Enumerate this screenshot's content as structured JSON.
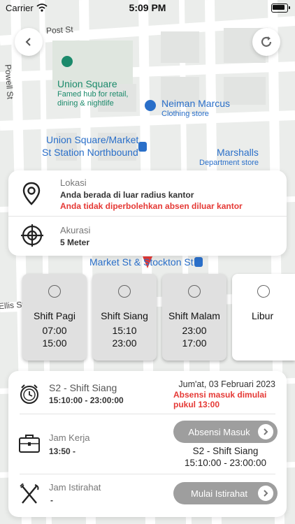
{
  "status_bar": {
    "carrier": "Carrier",
    "time": "5:09 PM"
  },
  "map": {
    "streets": [
      "Post St",
      "Powell St",
      "Ellis St",
      "Market St & Stockton St"
    ],
    "pois": [
      {
        "name": "Union Square",
        "desc1": "Famed hub for retail,",
        "desc2": "dining & nightlife"
      },
      {
        "name": "Neiman Marcus",
        "desc1": "Clothing store"
      },
      {
        "name": "Union Square/Market",
        "desc1": "St Station Northbound"
      },
      {
        "name": "Marshalls",
        "desc1": "Department store"
      }
    ]
  },
  "location_card": {
    "location_label": "Lokasi",
    "location_value": "Anda berada di luar radius kantor",
    "location_warning": "Anda tidak diperbolehkan absen diluar kantor",
    "accuracy_label": "Akurasi",
    "accuracy_value": "5 Meter"
  },
  "shifts": [
    {
      "name": "Shift Pagi",
      "start": "07:00",
      "end": "15:00"
    },
    {
      "name": "Shift Siang",
      "start": "15:10",
      "end": "23:00"
    },
    {
      "name": "Shift Malam",
      "start": "23:00",
      "end": "17:00"
    },
    {
      "name": "Libur"
    }
  ],
  "attendance_card": {
    "shift_title": "S2 - Shift Siang",
    "shift_time": "15:10:00 - 23:00:00",
    "date": "Jum'at, 03 Februari 2023",
    "notice_line1": "Absensi masuk dimulai",
    "notice_line2": "pukul 13:00",
    "work_label": "Jam Kerja",
    "work_value": "13:50 -",
    "checkin_button": "Absensi Masuk",
    "shift_title_2": "S2 - Shift Siang",
    "shift_time_2": "15:10:00 - 23:00:00",
    "break_label": "Jam Istirahat",
    "break_value": "-",
    "break_button": "Mulai Istirahat"
  },
  "colors": {
    "warning": "#e53935",
    "button": "#9e9e9e",
    "pin": "#e53935"
  }
}
